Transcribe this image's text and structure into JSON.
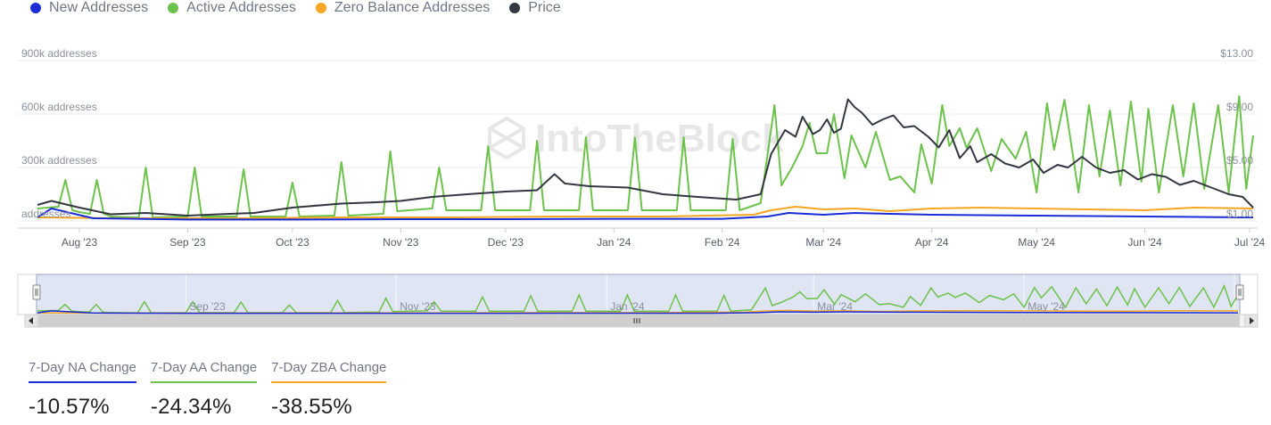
{
  "legend": [
    {
      "label": "New Addresses",
      "color": "#1a2cd6"
    },
    {
      "label": "Active Addresses",
      "color": "#6cc24a"
    },
    {
      "label": "Zero Balance Addresses",
      "color": "#f5a623"
    },
    {
      "label": "Price",
      "color": "#333740"
    }
  ],
  "stats": [
    {
      "label": "7-Day NA Change",
      "value": "-10.57%",
      "color": "#1a2cd6"
    },
    {
      "label": "7-Day AA Change",
      "value": "-24.34%",
      "color": "#6cc24a"
    },
    {
      "label": "7-Day ZBA Change",
      "value": "-38.55%",
      "color": "#f5a623"
    }
  ],
  "watermark": "IntoTheBlock",
  "navigator_labels": [
    "Sep '23",
    "Nov '23",
    "Jan '24",
    "Mar '24",
    "May '24"
  ],
  "chart_data": {
    "type": "line",
    "x_start": "2023-07-20",
    "x_end": "2024-07-02",
    "x_tick_labels": [
      "Aug '23",
      "Sep '23",
      "Oct '23",
      "Nov '23",
      "Dec '23",
      "Jan '24",
      "Feb '24",
      "Mar '24",
      "Apr '24",
      "May '24",
      "Jun '24",
      "Jul '24"
    ],
    "x_tick_dates": [
      "2023-08-01",
      "2023-09-01",
      "2023-10-01",
      "2023-11-01",
      "2023-12-01",
      "2024-01-01",
      "2024-02-01",
      "2024-03-01",
      "2024-04-01",
      "2024-05-01",
      "2024-06-01",
      "2024-07-01"
    ],
    "y_left": {
      "ticks": [
        0,
        300000,
        600000,
        900000
      ],
      "tick_labels": [
        "addresses",
        "300k addresses",
        "600k addresses",
        "900k addresses"
      ],
      "ylim": [
        0,
        900000
      ]
    },
    "y_right": {
      "ticks": [
        1,
        5,
        9,
        13
      ],
      "tick_labels": [
        "$1.00",
        "$5.00",
        "$9.00",
        "$13.00"
      ],
      "ylim": [
        1,
        13
      ]
    },
    "grid": true,
    "legend_position": "top-left",
    "series": [
      {
        "name": "Active Addresses",
        "axis": "left",
        "x": [
          "2023-07-20",
          "2023-07-26",
          "2023-07-28",
          "2023-07-30",
          "2023-08-01",
          "2023-08-04",
          "2023-08-06",
          "2023-08-08",
          "2023-08-10",
          "2023-08-18",
          "2023-08-20",
          "2023-08-22",
          "2023-09-01",
          "2023-09-03",
          "2023-09-05",
          "2023-09-15",
          "2023-09-17",
          "2023-09-19",
          "2023-09-29",
          "2023-10-01",
          "2023-10-03",
          "2023-10-13",
          "2023-10-15",
          "2023-10-17",
          "2023-10-27",
          "2023-10-29",
          "2023-10-31",
          "2023-11-10",
          "2023-11-12",
          "2023-11-14",
          "2023-11-24",
          "2023-11-26",
          "2023-11-28",
          "2023-12-08",
          "2023-12-10",
          "2023-12-12",
          "2023-12-22",
          "2023-12-24",
          "2023-12-26",
          "2024-01-05",
          "2024-01-07",
          "2024-01-09",
          "2024-01-19",
          "2024-01-21",
          "2024-01-23",
          "2024-02-02",
          "2024-02-04",
          "2024-02-06",
          "2024-02-12",
          "2024-02-16",
          "2024-02-18",
          "2024-02-21",
          "2024-02-24",
          "2024-02-26",
          "2024-02-28",
          "2024-03-02",
          "2024-03-04",
          "2024-03-07",
          "2024-03-09",
          "2024-03-13",
          "2024-03-16",
          "2024-03-20",
          "2024-03-23",
          "2024-03-27",
          "2024-03-29",
          "2024-04-01",
          "2024-04-04",
          "2024-04-06",
          "2024-04-09",
          "2024-04-11",
          "2024-04-14",
          "2024-04-18",
          "2024-04-21",
          "2024-04-25",
          "2024-04-28",
          "2024-05-01",
          "2024-05-04",
          "2024-05-06",
          "2024-05-09",
          "2024-05-13",
          "2024-05-16",
          "2024-05-19",
          "2024-05-22",
          "2024-05-25",
          "2024-05-28",
          "2024-05-31",
          "2024-06-02",
          "2024-06-05",
          "2024-06-09",
          "2024-06-12",
          "2024-06-15",
          "2024-06-18",
          "2024-06-22",
          "2024-06-25",
          "2024-06-28",
          "2024-06-30",
          "2024-07-02"
        ],
        "values": [
          70000,
          80000,
          230000,
          60000,
          50000,
          40000,
          230000,
          40000,
          25000,
          20000,
          300000,
          20000,
          25000,
          300000,
          25000,
          25000,
          290000,
          25000,
          25000,
          215000,
          25000,
          30000,
          330000,
          30000,
          40000,
          390000,
          55000,
          70000,
          300000,
          60000,
          60000,
          420000,
          60000,
          60000,
          450000,
          60000,
          60000,
          470000,
          60000,
          60000,
          470000,
          60000,
          60000,
          470000,
          60000,
          60000,
          460000,
          60000,
          100000,
          650000,
          200000,
          300000,
          420000,
          550000,
          380000,
          380000,
          600000,
          240000,
          480000,
          300000,
          500000,
          230000,
          250000,
          160000,
          430000,
          210000,
          650000,
          420000,
          520000,
          410000,
          520000,
          280000,
          460000,
          350000,
          500000,
          160000,
          660000,
          400000,
          680000,
          160000,
          650000,
          250000,
          620000,
          200000,
          670000,
          220000,
          630000,
          160000,
          650000,
          250000,
          660000,
          180000,
          650000,
          160000,
          700000,
          180000,
          480000
        ]
      },
      {
        "name": "Zero Balance Addresses",
        "axis": "left",
        "x": [
          "2023-07-20",
          "2023-08-15",
          "2023-09-15",
          "2023-10-15",
          "2023-11-15",
          "2023-12-15",
          "2024-01-15",
          "2024-02-10",
          "2024-02-15",
          "2024-02-22",
          "2024-03-01",
          "2024-03-10",
          "2024-03-20",
          "2024-04-01",
          "2024-04-15",
          "2024-05-01",
          "2024-05-15",
          "2024-06-01",
          "2024-06-15",
          "2024-07-02"
        ],
        "values": [
          20000,
          15000,
          15000,
          20000,
          20000,
          25000,
          25000,
          35000,
          60000,
          80000,
          65000,
          70000,
          55000,
          70000,
          75000,
          70000,
          65000,
          60000,
          75000,
          70000
        ]
      },
      {
        "name": "New Addresses",
        "axis": "left",
        "x": [
          "2023-07-20",
          "2023-07-24",
          "2023-08-05",
          "2023-09-01",
          "2023-10-01",
          "2023-11-01",
          "2023-12-01",
          "2024-01-01",
          "2024-02-01",
          "2024-02-14",
          "2024-02-20",
          "2024-03-01",
          "2024-03-10",
          "2024-03-20",
          "2024-04-01",
          "2024-05-01",
          "2024-06-01",
          "2024-07-02"
        ],
        "values": [
          20000,
          70000,
          15000,
          8000,
          8000,
          10000,
          10000,
          12000,
          12000,
          25000,
          45000,
          35000,
          45000,
          40000,
          35000,
          30000,
          25000,
          20000
        ]
      },
      {
        "name": "Price",
        "axis": "right",
        "x": [
          "2023-07-20",
          "2023-07-24",
          "2023-08-01",
          "2023-08-10",
          "2023-08-20",
          "2023-09-01",
          "2023-09-10",
          "2023-09-20",
          "2023-10-01",
          "2023-10-15",
          "2023-10-25",
          "2023-11-01",
          "2023-11-10",
          "2023-11-20",
          "2023-12-01",
          "2023-12-10",
          "2023-12-15",
          "2023-12-18",
          "2023-12-25",
          "2024-01-05",
          "2024-01-15",
          "2024-01-25",
          "2024-02-05",
          "2024-02-12",
          "2024-02-15",
          "2024-02-19",
          "2024-02-22",
          "2024-02-24",
          "2024-02-27",
          "2024-02-29",
          "2024-03-02",
          "2024-03-04",
          "2024-03-06",
          "2024-03-08",
          "2024-03-10",
          "2024-03-12",
          "2024-03-15",
          "2024-03-18",
          "2024-03-21",
          "2024-03-24",
          "2024-03-27",
          "2024-03-31",
          "2024-04-03",
          "2024-04-06",
          "2024-04-09",
          "2024-04-12",
          "2024-04-14",
          "2024-04-18",
          "2024-04-22",
          "2024-04-26",
          "2024-04-30",
          "2024-05-03",
          "2024-05-07",
          "2024-05-10",
          "2024-05-14",
          "2024-05-18",
          "2024-05-22",
          "2024-05-26",
          "2024-05-30",
          "2024-06-03",
          "2024-06-07",
          "2024-06-11",
          "2024-06-15",
          "2024-06-20",
          "2024-06-25",
          "2024-06-29",
          "2024-07-02"
        ],
        "values": [
          2.2,
          2.5,
          2.0,
          1.5,
          1.6,
          1.4,
          1.5,
          1.6,
          2.0,
          2.3,
          2.4,
          2.5,
          2.8,
          3.0,
          3.2,
          3.3,
          4.5,
          3.8,
          3.6,
          3.5,
          3.0,
          2.8,
          2.6,
          3.0,
          6.0,
          7.8,
          7.3,
          8.8,
          7.5,
          7.8,
          8.6,
          7.6,
          7.9,
          10.1,
          9.5,
          9.1,
          8.2,
          8.6,
          8.9,
          8.0,
          8.1,
          7.3,
          6.5,
          7.8,
          5.7,
          6.6,
          5.4,
          6.0,
          5.3,
          5.0,
          5.6,
          4.6,
          5.2,
          5.0,
          5.8,
          5.0,
          4.6,
          4.8,
          4.1,
          4.5,
          4.3,
          3.7,
          4.0,
          3.5,
          3.0,
          2.8,
          2.0
        ]
      }
    ]
  }
}
